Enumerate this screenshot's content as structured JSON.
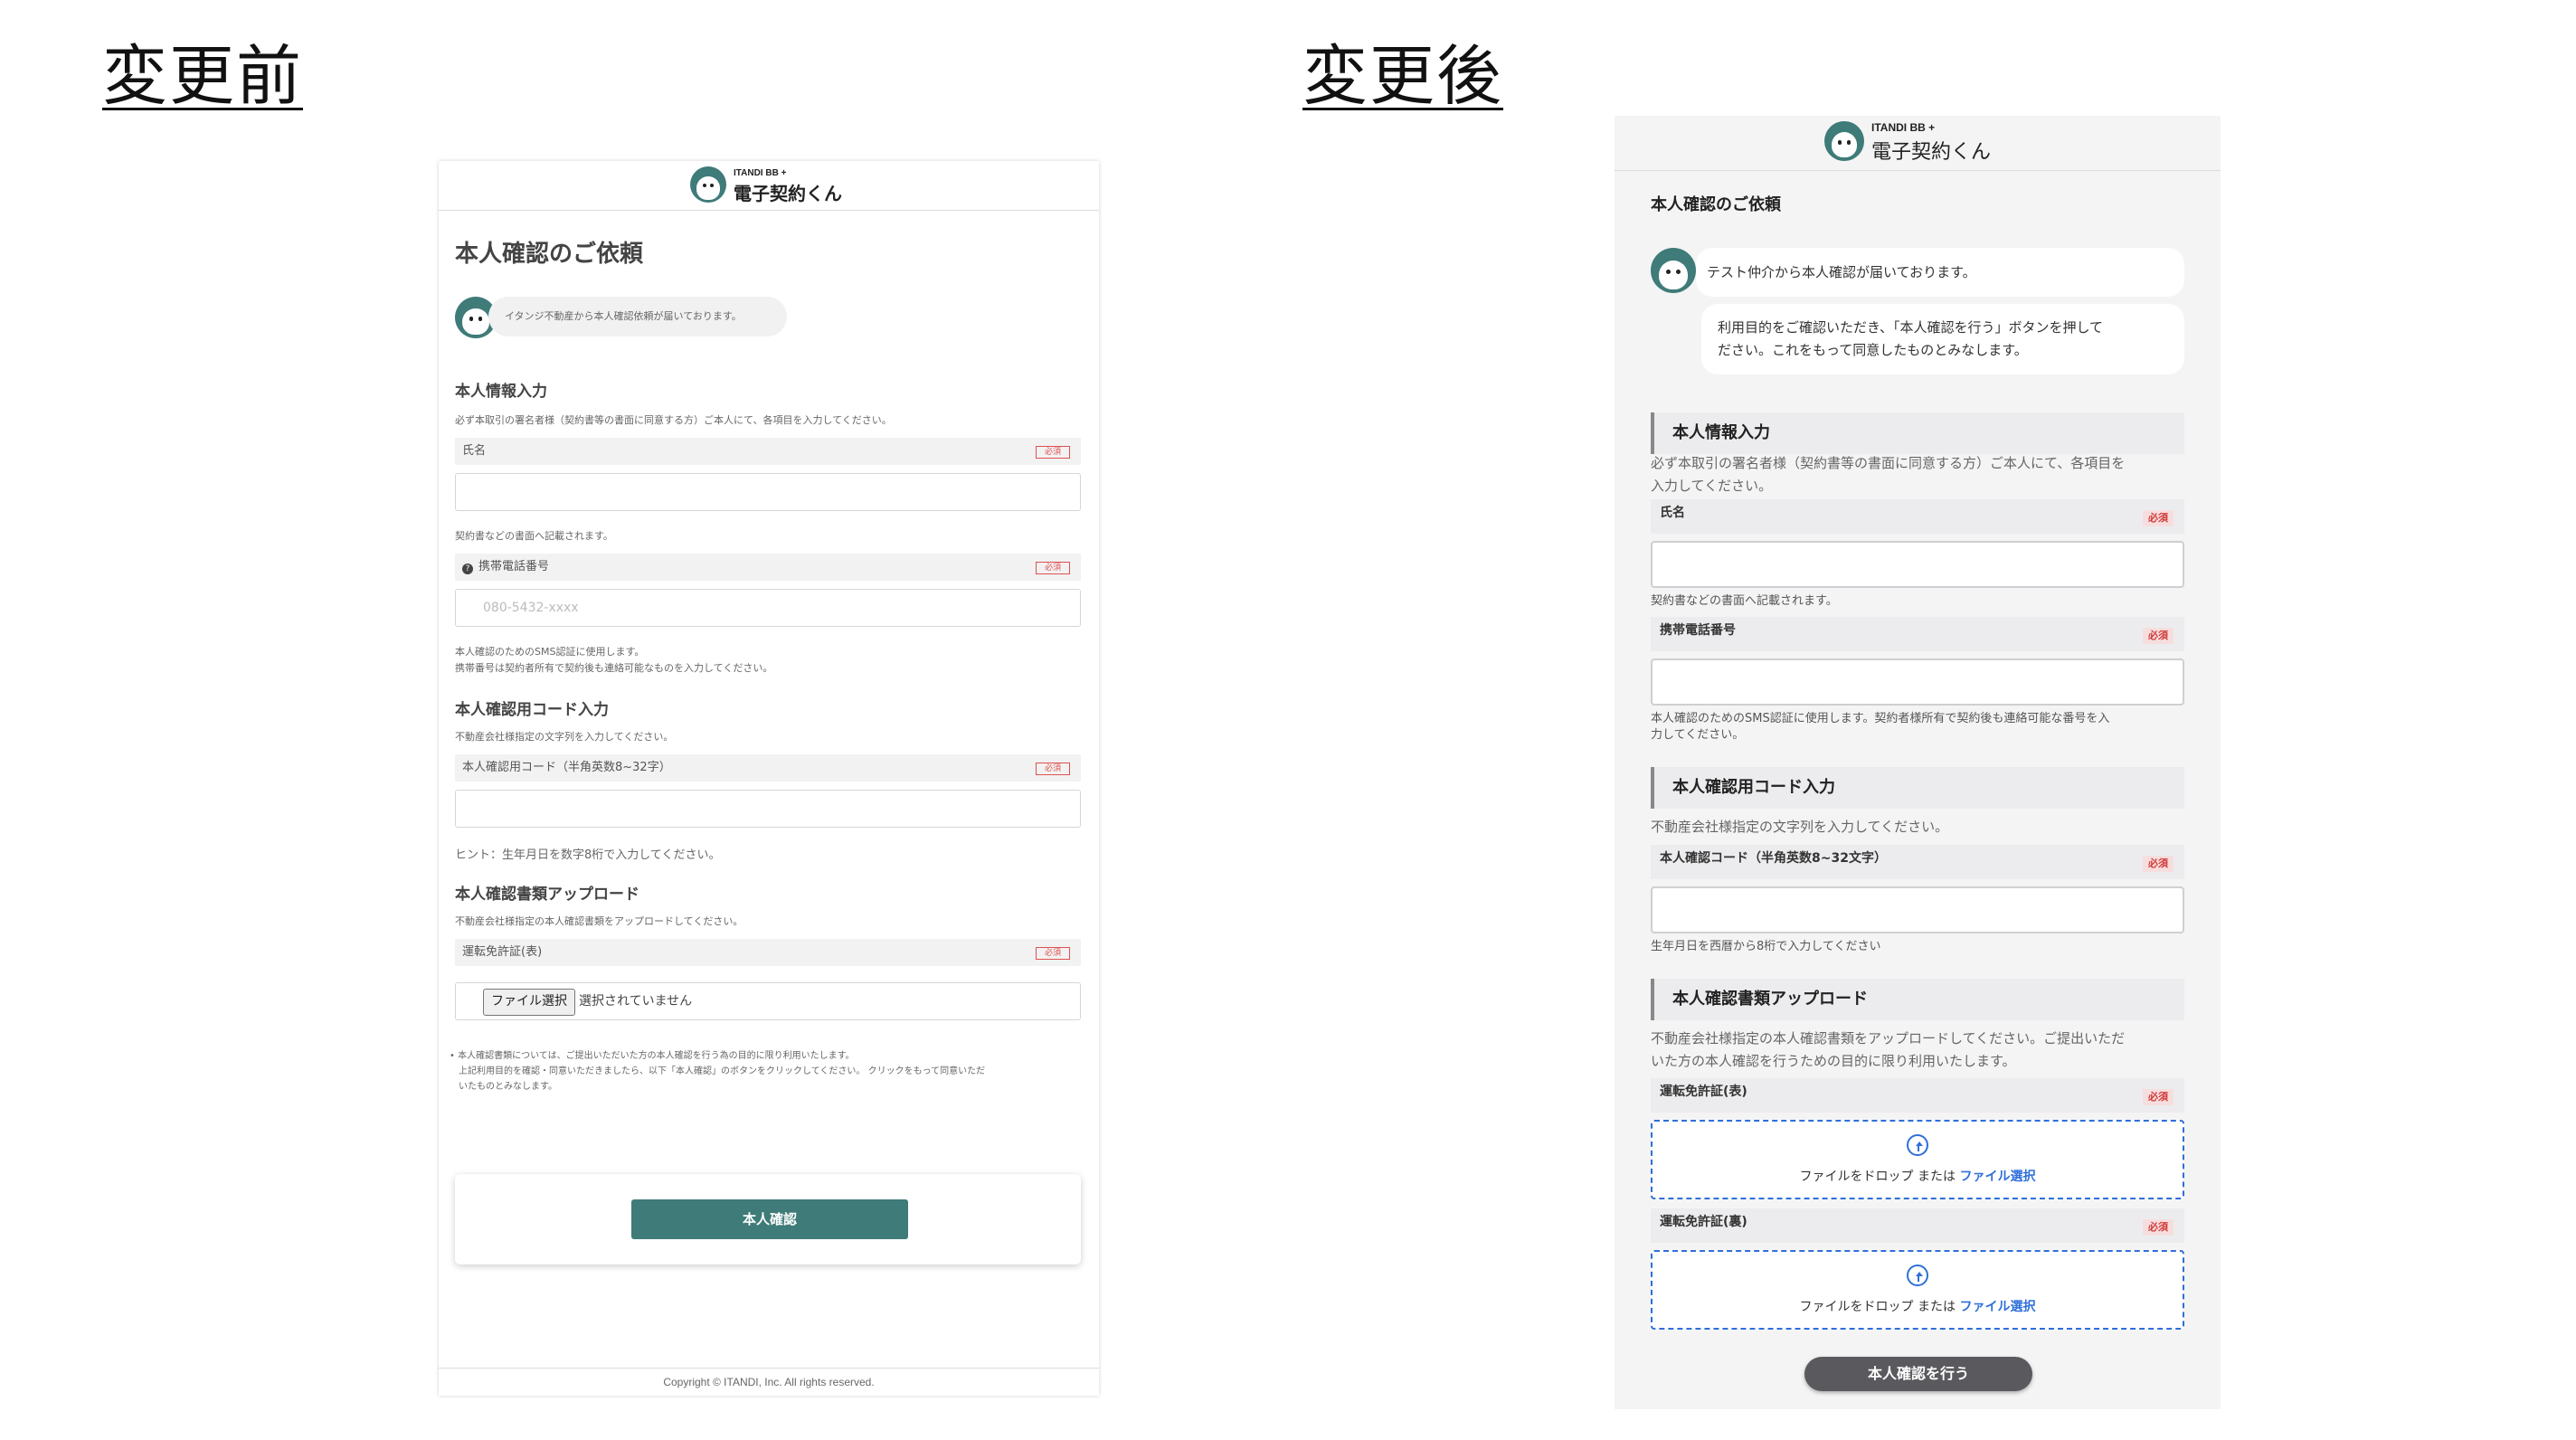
{
  "headings": {
    "before": "変更前",
    "after": "変更後"
  },
  "brand": {
    "top": "ITANDI BB +",
    "main": "電子契約くん"
  },
  "before": {
    "title": "本人確認のご依頼",
    "bubble": "イタンジ不動産から本人確認依頼が届いております。",
    "sec1": {
      "title": "本人情報入力",
      "note": "必ず本取引の署名者様（契約書等の書面に同意する方）ご本人にて、各項目を入力してください。"
    },
    "name_label": "氏名",
    "name_note": "契約書などの書面へ記載されます。",
    "phone_label": "携帯電話番号",
    "phone_placeholder": "080-5432-xxxx",
    "phone_note1": "本人確認のためのSMS認証に使用します。",
    "phone_note2": "携帯番号は契約者所有で契約後も連絡可能なものを入力してください。",
    "sec2": {
      "title": "本人確認用コード入力",
      "note": "不動産会社様指定の文字列を入力してください。"
    },
    "code_label": "本人確認用コード（半角英数8~32字）",
    "code_hint": "ヒント：生年月日を数字8桁で入力してください。",
    "sec3": {
      "title": "本人確認書類アップロード",
      "note": "不動産会社様指定の本人確認書類をアップロードしてください。"
    },
    "license_label": "運転免許証(表)",
    "file_button": "ファイル選択",
    "file_none": "選択されていません",
    "disclaimer1": "• 本人確認書類については、ご提出いただいた方の本人確認を行う為の目的に限り利用いたします。",
    "disclaimer2": "上記利用目的を確認・同意いただきましたら、以下「本人確認」のボタンをクリックしてください。 クリックをもって同意いただ",
    "disclaimer3": "いたものとみなします。",
    "required": "必須",
    "confirm_button": "本人確認",
    "footer": "Copyright © ITANDI, Inc. All rights reserved."
  },
  "after": {
    "title": "本人確認のご依頼",
    "bubble1": "テスト仲介から本人確認が届いております。",
    "bubble2_line1": "利用目的をご確認いただき、「本人確認を行う」ボタンを押して",
    "bubble2_line2": "ださい。これをもって同意したものとみなします。",
    "sec1": {
      "title": "本人情報入力",
      "note1": "必ず本取引の署名者様（契約書等の書面に同意する方）ご本人にて、各項目を",
      "note2": "入力してください。"
    },
    "name_label": "氏名",
    "name_note": "契約書などの書面へ記載されます。",
    "phone_label": "携帯電話番号",
    "phone_note1": "本人確認のためのSMS認証に使用します。契約者様所有で契約後も連絡可能な番号を入",
    "phone_note2": "力してください。",
    "sec2": {
      "title": "本人確認用コード入力",
      "note": "不動産会社様指定の文字列を入力してください。"
    },
    "code_label": "本人確認コード（半角英数8~32文字）",
    "code_hint": "生年月日を西暦から8桁で入力してください",
    "sec3": {
      "title": "本人確認書類アップロード",
      "note1": "不動産会社様指定の本人確認書類をアップロードしてください。ご提出いただ",
      "note2": "いた方の本人確認を行うための目的に限り利用いたします。"
    },
    "license_front_label": "運転免許証(表)",
    "license_back_label": "運転免許証(裏)",
    "drop_text": "ファイルをドロップ または ",
    "drop_link": "ファイル選択",
    "required": "必須",
    "submit_button": "本人確認を行う"
  },
  "colors": {
    "brand": "#3e7b79",
    "required": "#d03a3a",
    "link": "#2f6fd9",
    "submit": "#5a5a5e"
  }
}
